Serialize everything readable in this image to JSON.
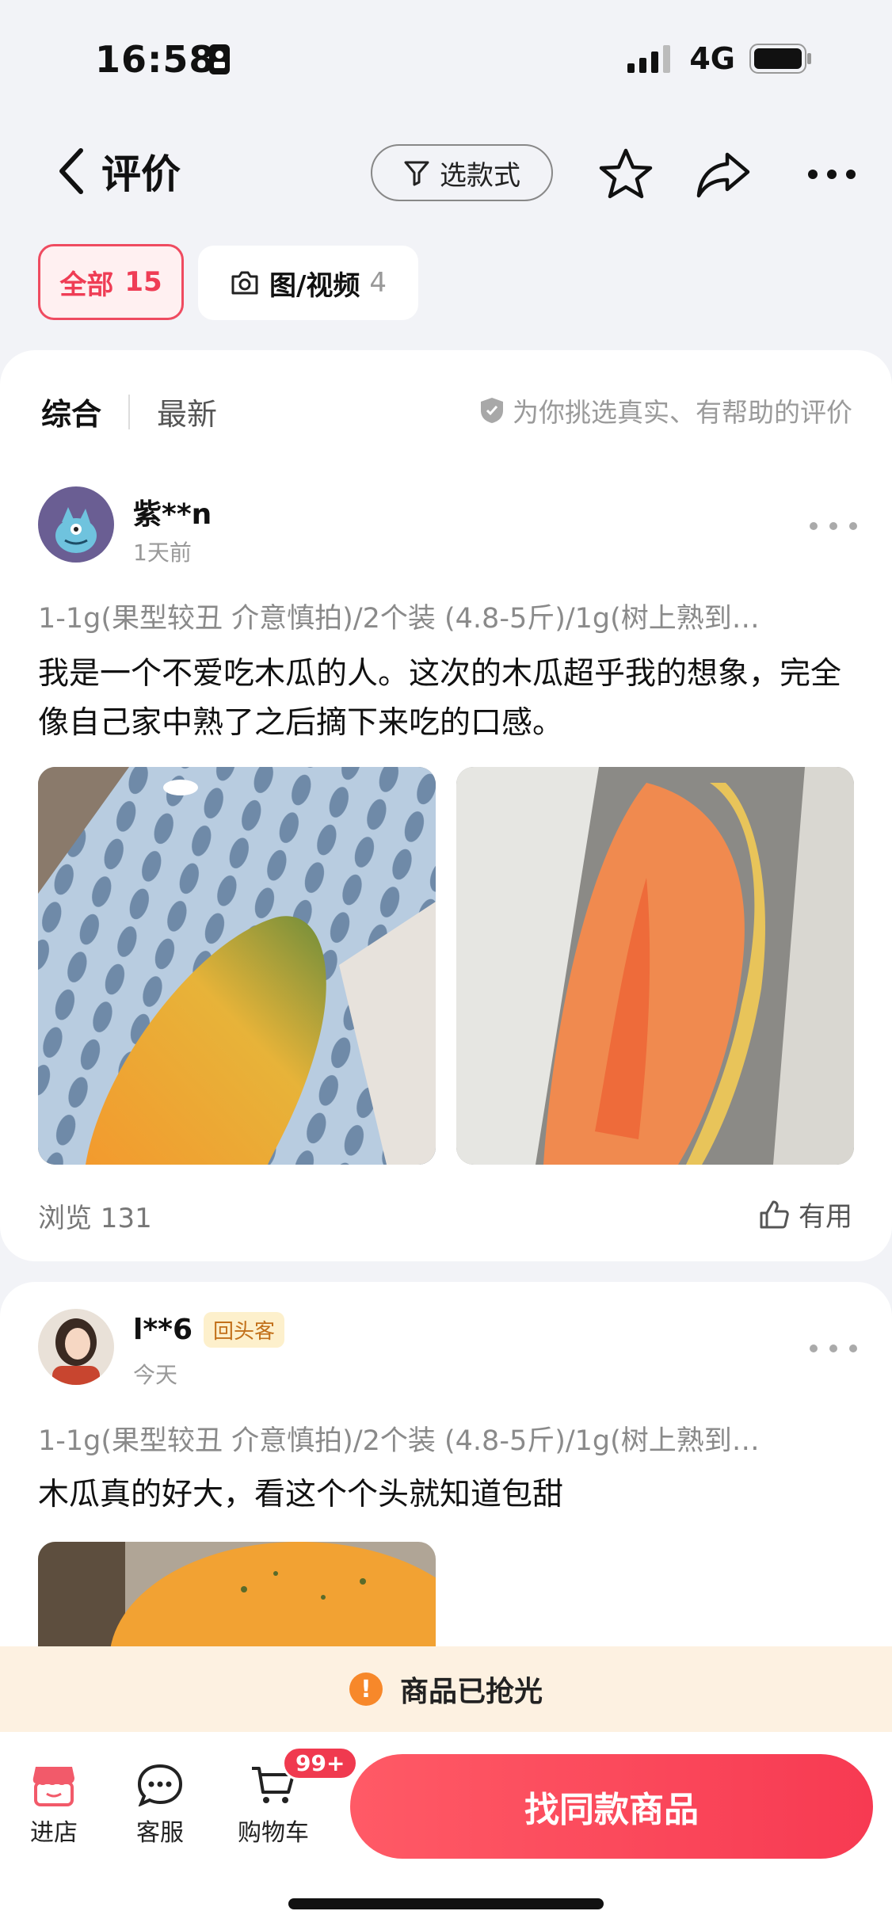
{
  "status": {
    "time": "16:58",
    "network": "4G"
  },
  "nav": {
    "title": "评价",
    "filter_label": "选款式"
  },
  "tabs": [
    {
      "label": "全部",
      "count": "15"
    },
    {
      "label": "图/视频",
      "count": "4"
    }
  ],
  "sort": {
    "active": "综合",
    "inactive": "最新",
    "hint": "为你挑选真实、有帮助的评价"
  },
  "reviews": [
    {
      "user": "紫**n",
      "time": "1天前",
      "spec": "1-1g(果型较丑 介意慎拍)/2个装 (4.8-5斤)/1g(树上熟到…",
      "text": "我是一个不爱吃木瓜的人。这次的木瓜超乎我的想象，完全像自己家中熟了之后摘下来吃的口感。",
      "views": "浏览 131",
      "useful": "有用"
    },
    {
      "user": "l**6",
      "badge": "回头客",
      "time": "今天",
      "spec": "1-1g(果型较丑 介意慎拍)/2个装 (4.8-5斤)/1g(树上熟到…",
      "text": "木瓜真的好大，看这个个头就知道包甜"
    }
  ],
  "banner": {
    "soldout": "商品已抢光"
  },
  "bottom": {
    "store": "进店",
    "service": "客服",
    "cart": "购物车",
    "cart_badge": "99+",
    "cta": "找同款商品"
  }
}
